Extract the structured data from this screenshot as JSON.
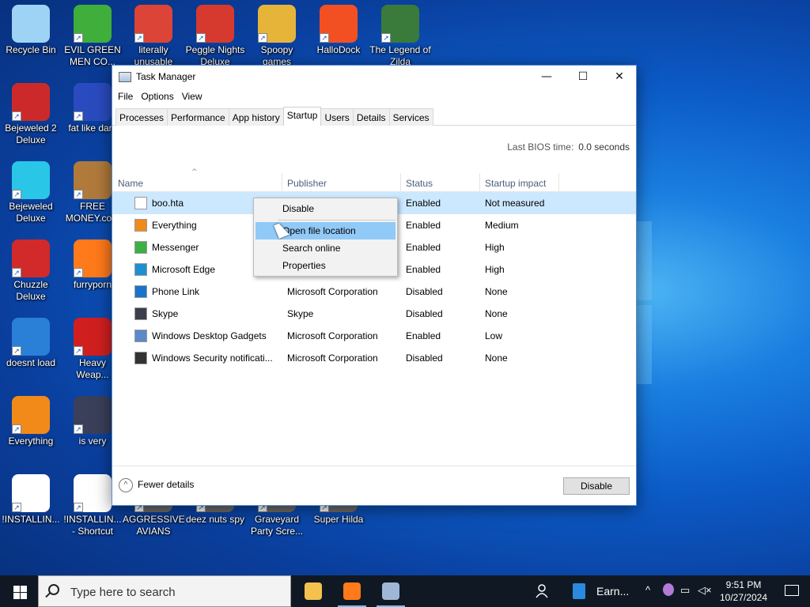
{
  "desktop": {
    "icons": [
      {
        "label": "Recycle Bin",
        "icon": "recycle-bin-icon",
        "color": "#9fd3f5"
      },
      {
        "label": "EVIL GREEN MEN CO...",
        "icon": "green-men-icon",
        "color": "#3fae3a"
      },
      {
        "label": "literally unusable",
        "icon": "chrome-icon",
        "color": "#db4437"
      },
      {
        "label": "Peggle Nights Deluxe",
        "icon": "peggle-icon",
        "color": "#d63a2f"
      },
      {
        "label": "Spoopy games",
        "icon": "folder-icon",
        "color": "#e7b43a"
      },
      {
        "label": "HalloDock",
        "icon": "windows-shield-icon",
        "color": "#f25022"
      },
      {
        "label": "The Legend of Zilda",
        "icon": "zilda-icon",
        "color": "#3a7a3a"
      },
      {
        "label": "Bejeweled 2 Deluxe",
        "icon": "bejeweled-2-icon",
        "color": "#cc2a2a"
      },
      {
        "label": "fat like dark",
        "icon": "mpl-icon",
        "color": "#2a4bbf"
      },
      {
        "label": "Bejeweled Deluxe",
        "icon": "gem-icon",
        "color": "#29c6e8"
      },
      {
        "label": "FREE MONEY.com",
        "icon": "money-bag-icon",
        "color": "#b07a3a"
      },
      {
        "label": "Chuzzle Deluxe",
        "icon": "chuzzle-icon",
        "color": "#d22a2a"
      },
      {
        "label": "furryporn",
        "icon": "firefox-icon",
        "color": "#ff7a1a"
      },
      {
        "label": "doesnt load",
        "icon": "thunderbird-icon",
        "color": "#2a7fd6"
      },
      {
        "label": "Heavy Weap...",
        "icon": "radiation-icon",
        "color": "#d11f1f"
      },
      {
        "label": "Everything",
        "icon": "everything-search-icon",
        "color": "#f28a1a"
      },
      {
        "label": "is very",
        "icon": "mpl-shield-icon",
        "color": "#3a3f5a"
      },
      {
        "label": "!INSTALLIN...",
        "icon": "text-file-icon",
        "color": "#ffffff"
      },
      {
        "label": "!INSTALLIN... - Shortcut",
        "icon": "text-file-shortcut-icon",
        "color": "#ffffff"
      },
      {
        "label": "AGGRESSIVE AVIANS",
        "icon": "game-icon",
        "color": "#6a6a6a"
      },
      {
        "label": "deez nuts spy",
        "icon": "game-icon",
        "color": "#6a6a6a"
      },
      {
        "label": "Graveyard Party Scre...",
        "icon": "game-icon",
        "color": "#6a6a6a"
      },
      {
        "label": "Super Hilda",
        "icon": "game-icon",
        "color": "#6a6a6a"
      }
    ]
  },
  "window": {
    "title": "Task Manager",
    "controls": {
      "minimize": "—",
      "maximize": "☐",
      "close": "✕"
    },
    "menu": [
      "File",
      "Options",
      "View"
    ],
    "tabs": [
      {
        "label": "Processes",
        "active": false
      },
      {
        "label": "Performance",
        "active": false
      },
      {
        "label": "App history",
        "active": false
      },
      {
        "label": "Startup",
        "active": true
      },
      {
        "label": "Users",
        "active": false
      },
      {
        "label": "Details",
        "active": false
      },
      {
        "label": "Services",
        "active": false
      }
    ],
    "bios": {
      "label": "Last BIOS time:",
      "value": "0.0 seconds"
    },
    "columns": [
      "Name",
      "Publisher",
      "Status",
      "Startup impact"
    ],
    "rows": [
      {
        "name": "boo.hta",
        "publisher": "",
        "status": "Enabled",
        "impact": "Not measured",
        "icon": "file-icon",
        "color": "#ffffff",
        "selected": true
      },
      {
        "name": "Everything",
        "publisher": "",
        "status": "Enabled",
        "impact": "Medium",
        "icon": "everything-search-icon",
        "color": "#f28a1a",
        "selected": false
      },
      {
        "name": "Messenger",
        "publisher": "",
        "status": "Enabled",
        "impact": "High",
        "icon": "messenger-icon",
        "color": "#3cb043",
        "selected": false
      },
      {
        "name": "Microsoft Edge",
        "publisher": "",
        "status": "Enabled",
        "impact": "High",
        "icon": "edge-icon",
        "color": "#1f8fd1",
        "selected": false
      },
      {
        "name": "Phone Link",
        "publisher": "Microsoft Corporation",
        "status": "Disabled",
        "impact": "None",
        "icon": "phone-link-icon",
        "color": "#1a73c8",
        "selected": false
      },
      {
        "name": "Skype",
        "publisher": "Skype",
        "status": "Disabled",
        "impact": "None",
        "icon": "skype-icon",
        "color": "#3a3f4a",
        "selected": false
      },
      {
        "name": "Windows Desktop Gadgets",
        "publisher": "Microsoft Corporation",
        "status": "Enabled",
        "impact": "Low",
        "icon": "gadgets-icon",
        "color": "#5a8ac8",
        "selected": false
      },
      {
        "name": "Windows Security notificati...",
        "publisher": "Microsoft Corporation",
        "status": "Disabled",
        "impact": "None",
        "icon": "shield-icon",
        "color": "#333333",
        "selected": false
      }
    ],
    "footer": {
      "fewer_details": "Fewer details",
      "disable_button": "Disable"
    }
  },
  "context_menu": {
    "items": [
      "Disable",
      "Open file location",
      "Search online",
      "Properties"
    ],
    "highlighted": "Open file location"
  },
  "taskbar": {
    "search_placeholder": "Type here to search",
    "pinned": [
      {
        "icon": "file-explorer-icon",
        "color": "#f2c14e"
      },
      {
        "icon": "firefox-icon",
        "color": "#ff7a1a"
      },
      {
        "icon": "task-manager-icon",
        "color": "#9fb7d6"
      }
    ],
    "running_app": "Earn...",
    "clock": {
      "time": "9:51 PM",
      "date": "10/27/2024"
    }
  }
}
